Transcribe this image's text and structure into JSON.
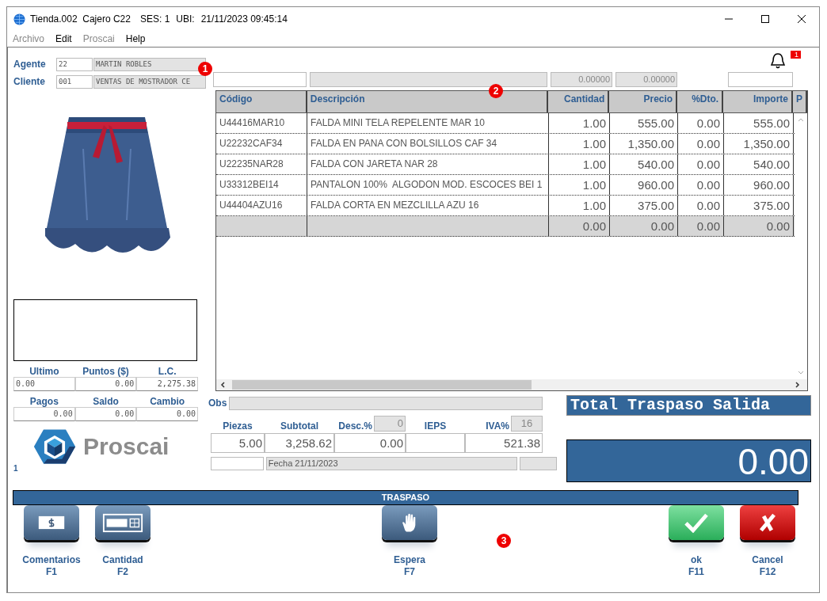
{
  "window": {
    "title": "Tienda.002  Cajero C22",
    "session": "SES: 1",
    "location": "UBI:",
    "datetime": "21/11/2023 09:45:14"
  },
  "menu": [
    {
      "label": "Archivo",
      "disabled": true
    },
    {
      "label": "Edit",
      "disabled": false
    },
    {
      "label": "Proscai",
      "disabled": true
    },
    {
      "label": "Help",
      "disabled": false
    }
  ],
  "agent": {
    "label": "Agente",
    "code": "22",
    "name": "MARTIN ROBLES"
  },
  "client": {
    "label": "Cliente",
    "code": "001",
    "name": "VENTAS DE MOSTRADOR CE"
  },
  "notifications": {
    "count": "1"
  },
  "entry": {
    "value_1": "0.00000",
    "value_2": "0.00000"
  },
  "table": {
    "columns": [
      "Código",
      "Descripción",
      "Cantidad",
      "Precio",
      "%Dto.",
      "Importe",
      "P"
    ],
    "rows": [
      [
        "U44416MAR10",
        "FALDA MINI TELA REPELENTE MAR 10",
        "1.00",
        "555.00",
        "0.00",
        "555.00"
      ],
      [
        "U22232CAF34",
        "FALDA EN PANA CON BOLSILLOS CAF 34",
        "1.00",
        "1,350.00",
        "0.00",
        "1,350.00"
      ],
      [
        "U22235NAR28",
        "FALDA CON JARETA NAR 28",
        "1.00",
        "540.00",
        "0.00",
        "540.00"
      ],
      [
        "U33312BEI14",
        "PANTALON 100%  ALGODON MOD. ESCOCES BEI 1",
        "1.00",
        "960.00",
        "0.00",
        "960.00"
      ],
      [
        "U44404AZU16",
        "FALDA CORTA EN MEZCLILLA AZU 16",
        "1.00",
        "375.00",
        "0.00",
        "375.00"
      ]
    ],
    "totals": [
      "0.00",
      "0.00",
      "0.00",
      "0.00"
    ]
  },
  "account": {
    "labels": [
      "Ultimo",
      "Puntos ($)",
      "L.C."
    ],
    "values": [
      "0.00",
      "0.00",
      "2,275.38"
    ]
  },
  "payments": {
    "labels": [
      "Pagos",
      "Saldo",
      "Cambio"
    ],
    "values": [
      "0.00",
      "0.00",
      "0.00"
    ]
  },
  "logo": {
    "text": "Proscai"
  },
  "page_number": "1",
  "obs": {
    "label": "Obs"
  },
  "summary": {
    "fields": [
      {
        "label": "Piezas",
        "value": "5.00"
      },
      {
        "label": "Subtotal",
        "value": "3,258.62"
      },
      {
        "label": "Desc.%",
        "value": "0.00"
      },
      {
        "label": "IEPS"
      },
      {
        "label": "IVA%",
        "value": "521.38"
      }
    ],
    "desc_pct": "0",
    "iva_pct": "16",
    "date": "Fecha 21/11/2023"
  },
  "total": {
    "title": "Total Traspaso Salida",
    "amount": "0.00"
  },
  "mode_bar": "TRASPASO",
  "actions": [
    {
      "kind": "money",
      "label": "Comentarios",
      "key": "F1"
    },
    {
      "kind": "calculator",
      "label": "Cantidad",
      "key": "F2"
    },
    {
      "kind": "hand",
      "label": "Espera",
      "key": "F7"
    },
    {
      "kind": "ok",
      "label": "ok",
      "key": "F11"
    },
    {
      "kind": "cancel",
      "label": "Cancel",
      "key": "F12"
    }
  ],
  "callouts": [
    "1",
    "2",
    "3"
  ]
}
